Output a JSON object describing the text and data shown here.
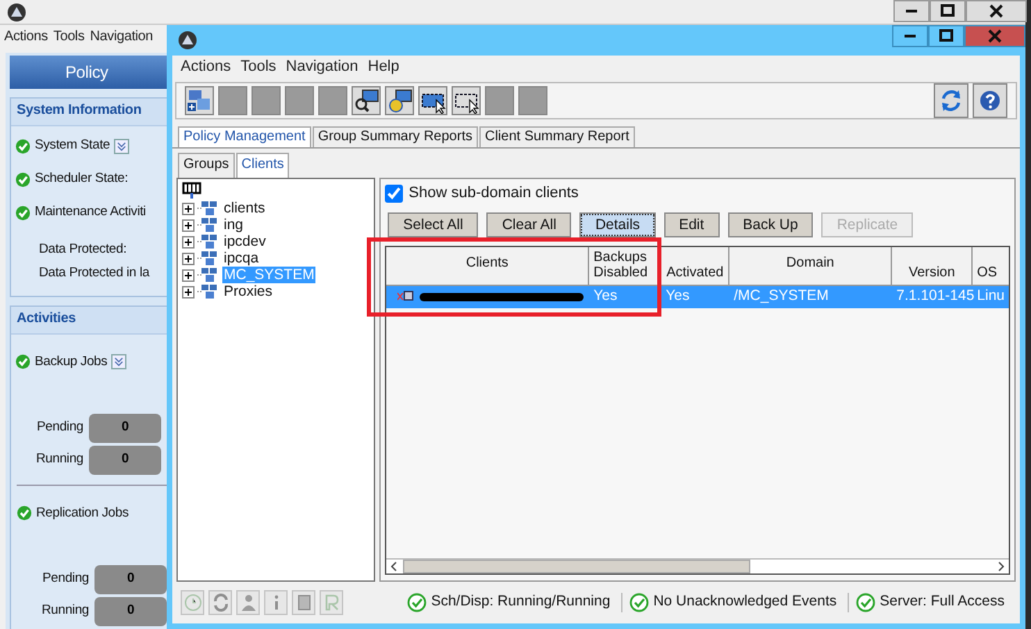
{
  "back_window": {
    "menu": [
      "Actions",
      "Tools",
      "Navigation"
    ],
    "controls": [
      {
        "kind": "minimize"
      },
      {
        "kind": "maximize"
      },
      {
        "kind": "close"
      }
    ],
    "header": "Policy",
    "system_information": {
      "title": "System Information",
      "items": [
        {
          "label": "System State",
          "expander": true
        },
        {
          "label": "Scheduler State:",
          "expander": false
        },
        {
          "label": "Maintenance Activiti",
          "expander": false
        }
      ],
      "data": [
        "Data Protected:",
        "Data Protected in la"
      ]
    },
    "activities": {
      "title": "Activities",
      "groups": [
        {
          "label": "Backup Jobs",
          "counters": [
            {
              "label": "Pending",
              "value": "0"
            },
            {
              "label": "Running",
              "value": "0"
            }
          ]
        },
        {
          "label": "Replication Jobs",
          "counters": [
            {
              "label": "Pending",
              "value": "0"
            },
            {
              "label": "Running",
              "value": "0"
            }
          ]
        }
      ]
    }
  },
  "window": {
    "controls": [
      {
        "kind": "minimize"
      },
      {
        "kind": "maximize"
      },
      {
        "kind": "close"
      }
    ],
    "menu": [
      "Actions",
      "Tools",
      "Navigation",
      "Help"
    ],
    "toolbar": [
      {
        "kind": "new-policy",
        "disabled": false
      },
      {
        "kind": "blank",
        "disabled": true
      },
      {
        "kind": "blank",
        "disabled": true
      },
      {
        "kind": "blank",
        "disabled": true
      },
      {
        "kind": "blank",
        "disabled": true
      },
      {
        "kind": "find-client",
        "disabled": false
      },
      {
        "kind": "client-globe",
        "disabled": false
      },
      {
        "kind": "select",
        "disabled": false
      },
      {
        "kind": "select-outline",
        "disabled": false
      },
      {
        "kind": "blank",
        "disabled": true
      },
      {
        "kind": "blank",
        "disabled": true
      }
    ],
    "toolbar_right": [
      {
        "kind": "refresh"
      },
      {
        "kind": "help"
      }
    ],
    "tabs": [
      {
        "label": "Policy Management",
        "selected": true
      },
      {
        "label": "Group Summary Reports",
        "selected": false
      },
      {
        "label": "Client Summary Report",
        "selected": false
      }
    ],
    "subtabs": [
      {
        "label": "Groups",
        "selected": false
      },
      {
        "label": "Clients",
        "selected": true
      }
    ],
    "tree": [
      {
        "label": "clients",
        "selected": false
      },
      {
        "label": "ing",
        "selected": false
      },
      {
        "label": "ipcdev",
        "selected": false
      },
      {
        "label": "ipcqa",
        "selected": false
      },
      {
        "label": "MC_SYSTEM",
        "selected": true
      },
      {
        "label": "Proxies",
        "selected": false
      }
    ],
    "show_subdomain": {
      "label": "Show sub-domain clients",
      "checked": true
    },
    "buttons": [
      {
        "label": "Select All",
        "disabled": false,
        "focused": false
      },
      {
        "label": "Clear All",
        "disabled": false,
        "focused": false
      },
      {
        "label": "Details",
        "disabled": false,
        "focused": true
      },
      {
        "label": "Edit",
        "disabled": false,
        "focused": false
      },
      {
        "label": "Back Up",
        "disabled": false,
        "focused": false
      },
      {
        "label": "Replicate",
        "disabled": true,
        "focused": false
      }
    ],
    "table": {
      "columns": [
        "Clients",
        "Backups Disabled",
        "Activated",
        "Domain",
        "Version",
        "OS"
      ],
      "rows": [
        {
          "selected": true,
          "cells": [
            {
              "kind": "redacted"
            },
            {
              "kind": "text",
              "text": "Yes"
            },
            {
              "kind": "text",
              "text": "Yes"
            },
            {
              "kind": "text",
              "text": "/MC_SYSTEM"
            },
            {
              "kind": "text",
              "text": "7.1.101-145"
            },
            {
              "kind": "text",
              "text": "Linu"
            }
          ]
        }
      ]
    },
    "bottom_toolbar": [
      {
        "kind": "clock",
        "disabled": true
      },
      {
        "kind": "sync",
        "disabled": true
      },
      {
        "kind": "person",
        "disabled": true
      },
      {
        "kind": "info",
        "disabled": true
      },
      {
        "kind": "book",
        "disabled": true
      },
      {
        "kind": "report",
        "disabled": true
      }
    ],
    "status_bar": [
      "Sch/Disp: Running/Running",
      "No Unacknowledged Events",
      "Server: Full Access"
    ]
  }
}
